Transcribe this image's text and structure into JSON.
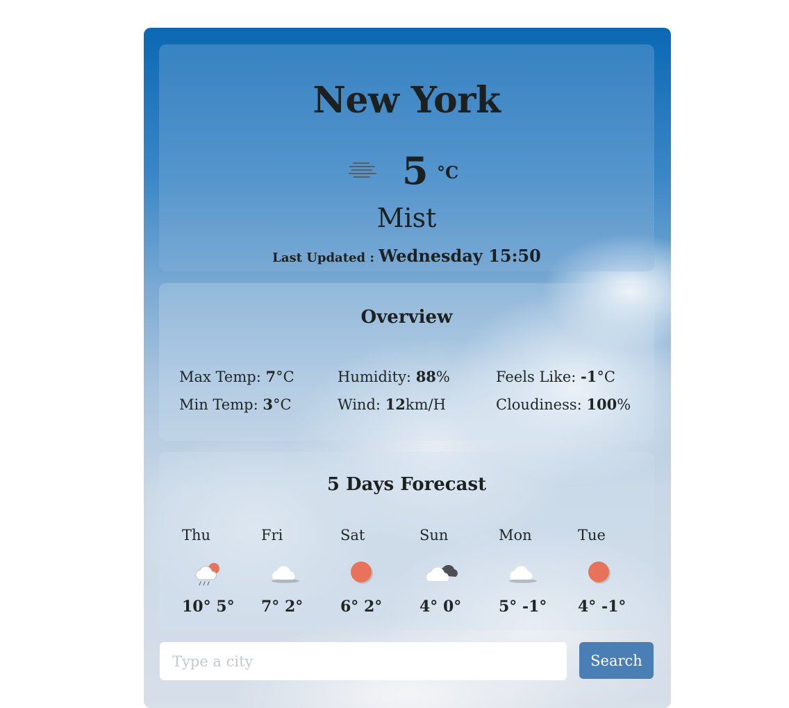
{
  "current": {
    "city": "New York",
    "temperature": "5",
    "unit": "°C",
    "description": "Mist",
    "last_updated_label": "Last Updated : ",
    "last_updated_value": "Wednesday 15:50",
    "icon": "mist-icon"
  },
  "overview": {
    "title": "Overview",
    "items": [
      {
        "label": "Max Temp: ",
        "value": "7",
        "unit": "°C"
      },
      {
        "label": "Humidity: ",
        "value": "88",
        "unit": "%"
      },
      {
        "label": "Feels Like: ",
        "value": "-1",
        "unit": "°C"
      },
      {
        "label": "Min Temp: ",
        "value": "3",
        "unit": "°C"
      },
      {
        "label": "Wind: ",
        "value": "12",
        "unit": "km/H"
      },
      {
        "label": "Cloudiness: ",
        "value": "100",
        "unit": "%"
      }
    ]
  },
  "forecast": {
    "title": "5 Days Forecast",
    "days": [
      {
        "day": "Thu",
        "temps": "10° 5°",
        "icon": "rain-cloud-sun-icon"
      },
      {
        "day": "Fri",
        "temps": "7° 2°",
        "icon": "cloud-icon"
      },
      {
        "day": "Sat",
        "temps": "6° 2°",
        "icon": "sun-icon"
      },
      {
        "day": "Sun",
        "temps": "4° 0°",
        "icon": "broken-clouds-icon"
      },
      {
        "day": "Mon",
        "temps": "5° -1°",
        "icon": "cloud-icon"
      },
      {
        "day": "Tue",
        "temps": "4° -1°",
        "icon": "sun-icon"
      }
    ]
  },
  "search": {
    "placeholder": "Type a city",
    "value": "",
    "button_label": "Search"
  },
  "colors": {
    "accent": "#4a7fb6",
    "sun": "#e8735a",
    "text": "#1c2120"
  }
}
